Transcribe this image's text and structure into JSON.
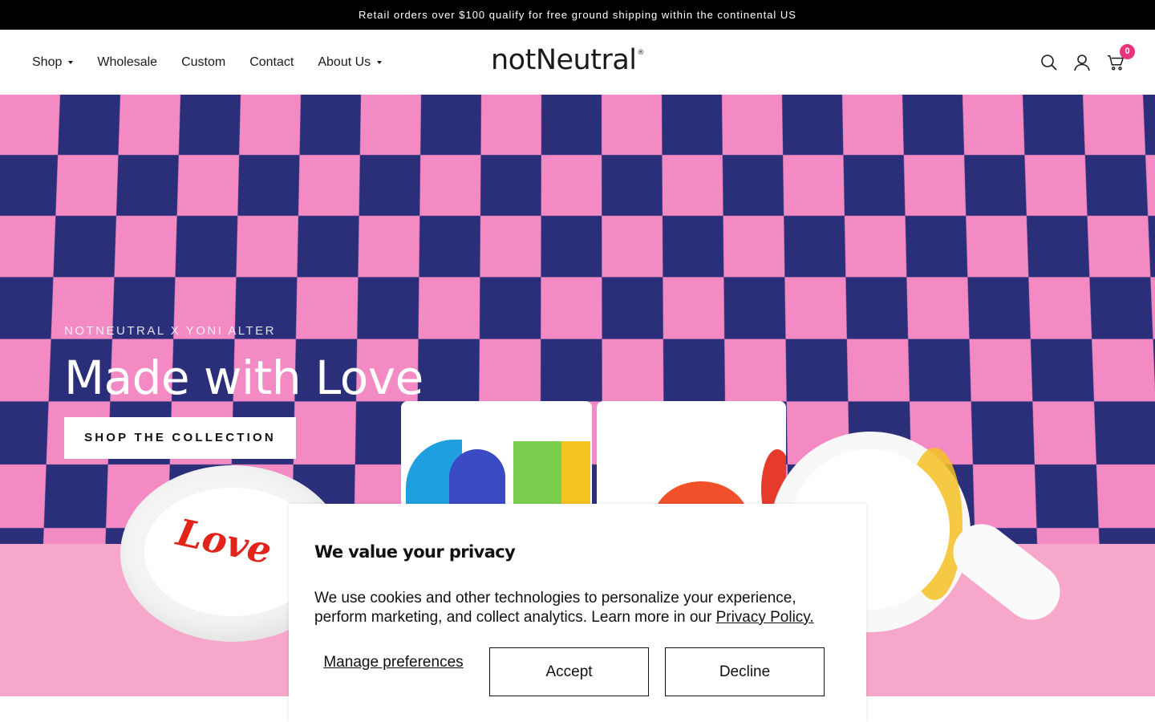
{
  "announcement": {
    "text": "Retail orders over $100 qualify for free ground shipping within the continental US"
  },
  "header": {
    "nav": [
      {
        "label": "Shop",
        "has_dropdown": true
      },
      {
        "label": "Wholesale",
        "has_dropdown": false
      },
      {
        "label": "Custom",
        "has_dropdown": false
      },
      {
        "label": "Contact",
        "has_dropdown": false
      },
      {
        "label": "About Us",
        "has_dropdown": true
      }
    ],
    "logo": {
      "text": "notNeutral",
      "mark": "®"
    },
    "icons": [
      "search-icon",
      "account-icon",
      "cart-icon"
    ],
    "cart_count": "0"
  },
  "hero": {
    "kicker": "NOTNEUTRAL X YONI ALTER",
    "title": "Made with Love",
    "button_label": "SHOP THE COLLECTION",
    "mug_text": "Love"
  },
  "cookie_banner": {
    "title": "We value your privacy",
    "body": "We use cookies and other technologies to personalize your experience, perform marketing, and collect analytics. Learn more in our ",
    "link_label": "Privacy Policy.",
    "manage_label": "Manage preferences",
    "accept_label": "Accept",
    "decline_label": "Decline"
  },
  "colors": {
    "announcement_bg": "#000000",
    "cart_badge": "#e8347a",
    "checker_pink": "#f48ac4",
    "checker_navy": "#2b2f7a"
  }
}
